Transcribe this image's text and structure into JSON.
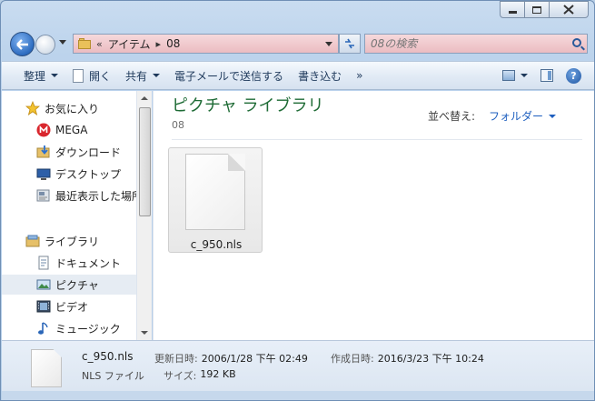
{
  "address": {
    "chevrons": "«",
    "crumbs": [
      "アイテム",
      "08"
    ],
    "separator": "▸"
  },
  "search": {
    "placeholder": "08の検索"
  },
  "toolbar": {
    "organize": "整理",
    "open": "開く",
    "share": "共有",
    "email": "電子メールで送信する",
    "burn": "書き込む",
    "more": "»",
    "help": "?"
  },
  "nav": {
    "favorites": "お気に入り",
    "mega": "MEGA",
    "downloads": "ダウンロード",
    "desktop": "デスクトップ",
    "recent": "最近表示した場所",
    "libraries": "ライブラリ",
    "documents": "ドキュメント",
    "pictures": "ピクチャ",
    "videos": "ビデオ",
    "music": "ミュージック"
  },
  "main": {
    "title": "ピクチャ ライブラリ",
    "subtitle": "08",
    "arrange_label": "並べ替え:",
    "arrange_value": "フォルダー",
    "files": [
      {
        "name": "c_950.nls"
      }
    ]
  },
  "details": {
    "name": "c_950.nls",
    "type": "NLS ファイル",
    "modified_label": "更新日時:",
    "modified_value": "2006/1/28 下午 02:49",
    "created_label": "作成日時:",
    "created_value": "2016/3/23 下午 10:24",
    "size_label": "サイズ:",
    "size_value": "192 KB"
  },
  "colors": {
    "title_green": "#1e6b35",
    "link_blue": "#1e5fbf",
    "address_bg": "#ebbcc1"
  }
}
